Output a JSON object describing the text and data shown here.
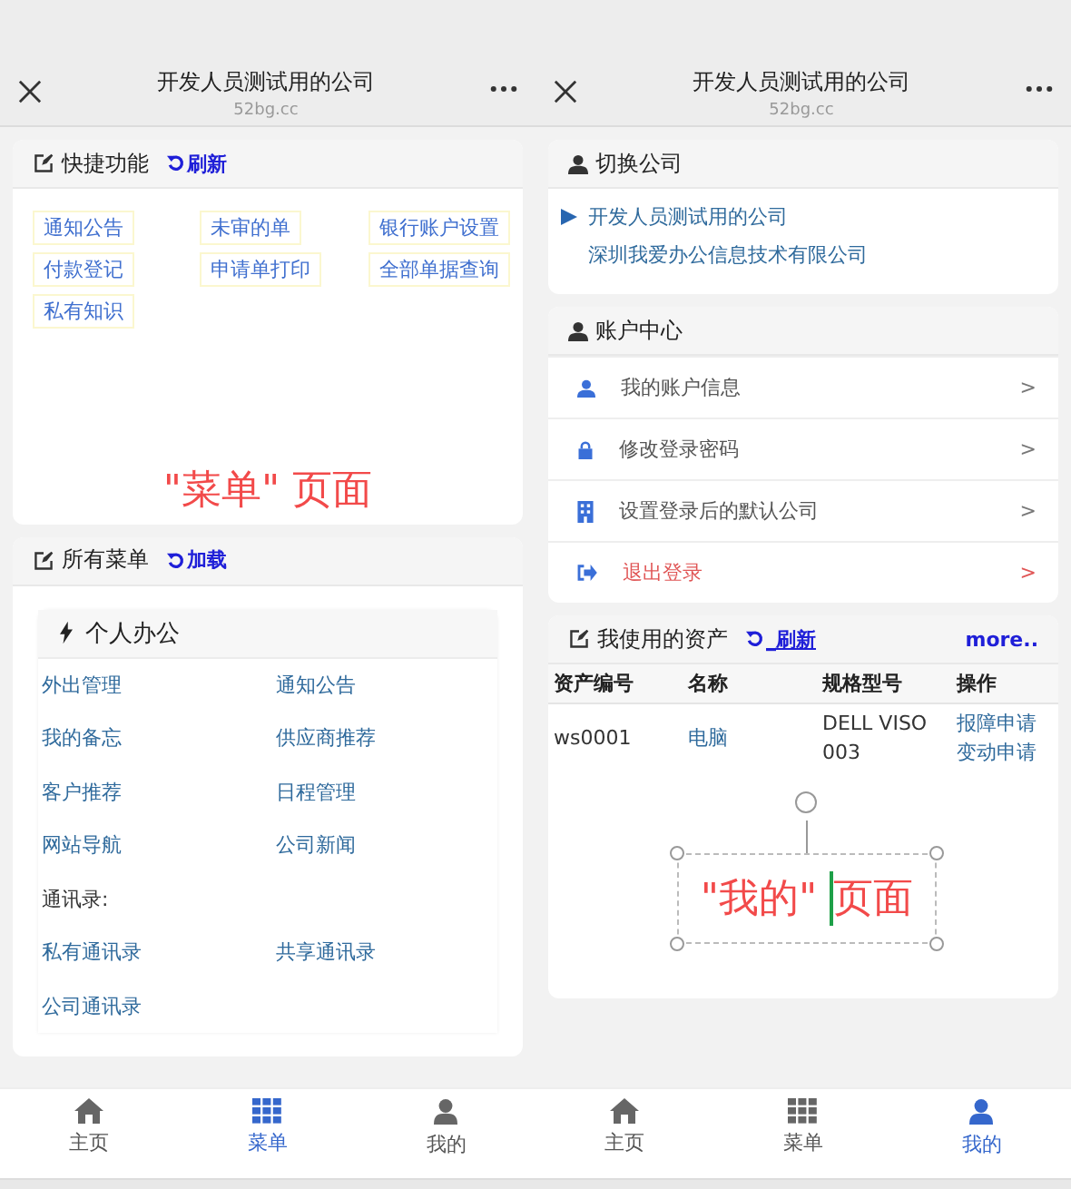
{
  "left_screen": {
    "header": {
      "title": "开发人员测试用的公司",
      "url": "52bg.cc"
    },
    "quick_card": {
      "title": "快捷功能",
      "action": "刷新",
      "links": [
        "通知公告",
        "未审的单",
        "银行账户设置",
        "付款登记",
        "申请单打印",
        "全部单据查询",
        "私有知识"
      ]
    },
    "annotation": "\"菜单\" 页面",
    "menu_card": {
      "title": "所有菜单",
      "action": "加载",
      "group": {
        "title": "个人办公",
        "items": [
          {
            "kind": "link",
            "label": "外出管理"
          },
          {
            "kind": "link",
            "label": "通知公告"
          },
          {
            "kind": "link",
            "label": "我的备忘"
          },
          {
            "kind": "link",
            "label": "供应商推荐"
          },
          {
            "kind": "link",
            "label": "客户推荐"
          },
          {
            "kind": "link",
            "label": "日程管理"
          },
          {
            "kind": "link",
            "label": "网站导航"
          },
          {
            "kind": "link",
            "label": "公司新闻"
          },
          {
            "kind": "heading",
            "label": "通讯录:"
          },
          {
            "kind": "link",
            "label": "私有通讯录"
          },
          {
            "kind": "link",
            "label": "共享通讯录"
          },
          {
            "kind": "link",
            "label": "公司通讯录"
          }
        ]
      }
    },
    "tab_bar": [
      {
        "label": "主页",
        "selected": false
      },
      {
        "label": "菜单",
        "selected": true
      },
      {
        "label": "我的",
        "selected": false
      }
    ]
  },
  "right_screen": {
    "header": {
      "title": "开发人员测试用的公司",
      "url": "52bg.cc"
    },
    "switch_company": {
      "title": "切换公司",
      "companies": [
        {
          "name": "开发人员测试用的公司",
          "selected": true
        },
        {
          "name": "深圳我爱办公信息技术有限公司",
          "selected": false
        }
      ]
    },
    "account_center": {
      "title": "账户中心",
      "items": [
        {
          "kind": "normal",
          "label": "我的账户信息",
          "arrow": ">"
        },
        {
          "kind": "normal",
          "label": "修改登录密码",
          "arrow": ">"
        },
        {
          "kind": "normal",
          "label": "设置登录后的默认公司",
          "arrow": ">"
        },
        {
          "kind": "danger",
          "label": "退出登录",
          "arrow": ">"
        }
      ]
    },
    "assets_card": {
      "title": "我使用的资产",
      "action": "_刷新",
      "more": "more..",
      "columns": [
        "资产编号",
        "名称",
        "规格型号",
        "操作"
      ],
      "rows": [
        {
          "asset_no": "ws0001",
          "name": "电脑",
          "model": "DELL VISO 003",
          "actions": [
            "报障申请",
            "变动申请"
          ]
        }
      ]
    },
    "annotation": {
      "before": "\"我的\" ",
      "after": "页面"
    },
    "tab_bar": [
      {
        "label": "主页",
        "selected": false
      },
      {
        "label": "菜单",
        "selected": false
      },
      {
        "label": "我的",
        "selected": true
      }
    ]
  }
}
